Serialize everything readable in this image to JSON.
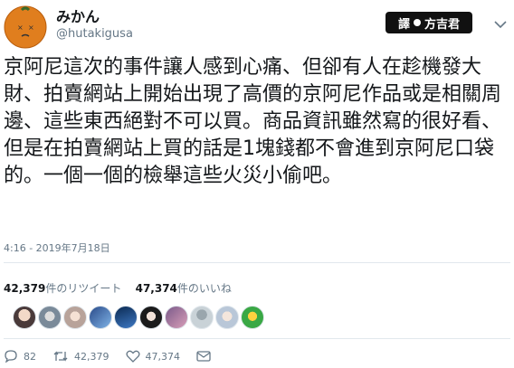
{
  "author": {
    "name": "みかん",
    "handle": "@hutakigusa",
    "avatar_icon": "orange-fruit-face-icon"
  },
  "badge": {
    "left": "譯",
    "right": "方吉君"
  },
  "tweet": {
    "text": "京阿尼這次的事件讓人感到心痛、但卻有人在趁機發大財、拍賣網站上開始出現了高價的京阿尼作品或是相關周邊、這些東西絕對不可以買。商品資訊雖然寫的很好看、但是在拍賣網站上買的話是1塊錢都不會進到京阿尼口袋的。一個一個的檢舉這些火災小偷吧。",
    "timestamp": "4:16 - 2019年7月18日"
  },
  "stats": {
    "retweets_count": "42,379",
    "retweets_label": "件のリツイート",
    "likes_count": "47,374",
    "likes_label": "件のいいね"
  },
  "likers": [
    "c1",
    "c2",
    "c3",
    "c4",
    "c5",
    "c6",
    "c7",
    "c8",
    "c9"
  ],
  "actions": {
    "replies": "82",
    "retweets": "42,379",
    "likes": "47,374"
  },
  "colors": {
    "muted": "#657786",
    "divider": "#e1e8ed",
    "text": "#14171a",
    "badge_bg": "#111111"
  }
}
